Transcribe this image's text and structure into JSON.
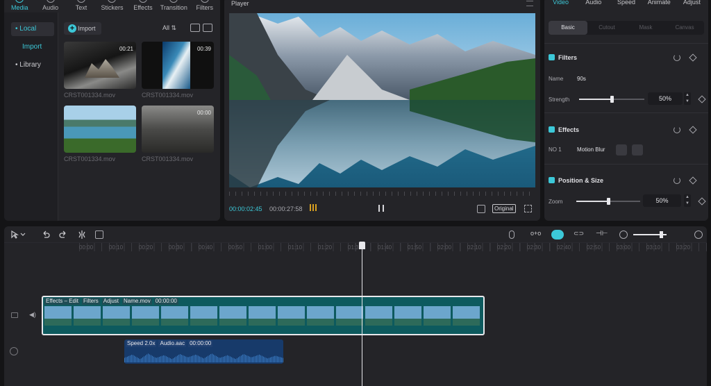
{
  "media": {
    "tabs": [
      {
        "label": "Media",
        "icon": "media-icon",
        "active": true
      },
      {
        "label": "Audio",
        "icon": "audio-icon"
      },
      {
        "label": "Text",
        "icon": "text-icon"
      },
      {
        "label": "Stickers",
        "icon": "stickers-icon"
      },
      {
        "label": "Effects",
        "icon": "effects-icon"
      },
      {
        "label": "Transition",
        "icon": "transition-icon"
      },
      {
        "label": "Filters",
        "icon": "filters-icon"
      }
    ],
    "sidebar": {
      "local": "• Local",
      "import": "Import",
      "library": "• Library"
    },
    "import_label": "Import",
    "filter_label": "All",
    "clips": [
      {
        "name": "CRST001334.mov",
        "duration": "00:21"
      },
      {
        "name": "CRST001334.mov",
        "duration": "00:39"
      },
      {
        "name": "CRST001334.mov",
        "duration": ""
      },
      {
        "name": "CRST001334.mov",
        "duration": "00:00"
      }
    ]
  },
  "player": {
    "title": "Player",
    "current_time": "00:00:02:45",
    "total_time": "00:00:27:58",
    "original_label": "Original"
  },
  "properties": {
    "tabs": [
      "Video",
      "Audio",
      "Speed",
      "Animate",
      "Adjust"
    ],
    "segments": [
      "Basic",
      "Cutout",
      "Mask",
      "Canvas"
    ],
    "filters": {
      "header": "Filters",
      "name_label": "Name",
      "name_value": "90s",
      "strength_label": "Strength",
      "strength_value": "50%",
      "strength_level": 0.5
    },
    "effects": {
      "header": "Effects",
      "item_label": "NO 1",
      "item_value": "Motion Blur"
    },
    "position": {
      "header": "Position & Size",
      "zoom_label": "Zoom",
      "zoom_value": "50%",
      "zoom_level": 0.5
    }
  },
  "timeline": {
    "ticks": [
      "00:00",
      "00:10",
      "00:20",
      "00:30",
      "00:40",
      "00:50",
      "01:00",
      "01:10",
      "01:20",
      "01:30",
      "01:40",
      "01:50",
      "02:00",
      "02:10",
      "02:20",
      "02:30",
      "02:40",
      "02:50",
      "03:00",
      "03:10",
      "03:20"
    ],
    "video_clip_labels": [
      "Effects – Edit",
      "Filters",
      "Adjust",
      "Name.mov",
      "00:00:00"
    ],
    "audio_clip_labels": [
      "Speed 2.0x",
      "Audio.aac",
      "00:00:00"
    ]
  },
  "colors": {
    "accent": "#3cc8d8",
    "panel": "#242428",
    "background": "#141416",
    "video_clip": "#0d5a5e",
    "audio_clip": "#173a6a"
  }
}
